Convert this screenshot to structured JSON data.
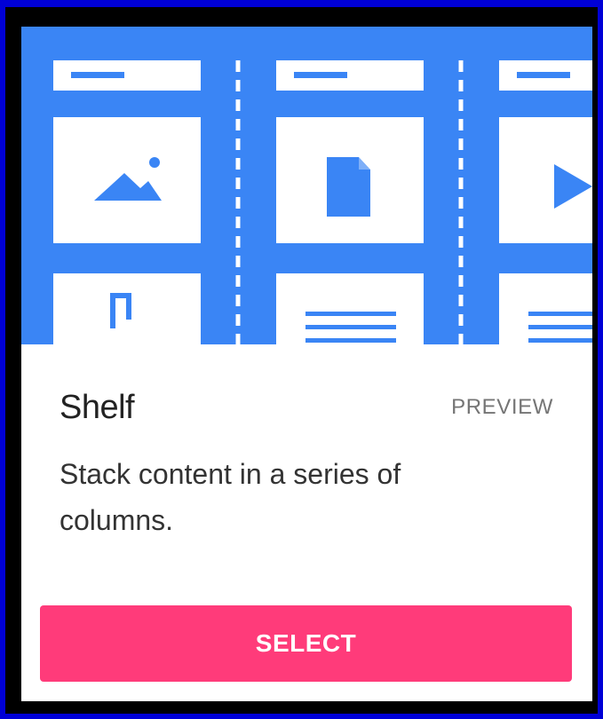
{
  "card": {
    "illustration": {
      "name": "shelf-layout-illustration",
      "background": "#3a85f5",
      "icons": [
        "image-icon",
        "document-icon",
        "play-icon",
        "music-icon"
      ]
    },
    "title": "Shelf",
    "preview_label": "PREVIEW",
    "description": "Stack content in a series of columns.",
    "select_label": "SELECT"
  },
  "colors": {
    "outer_border": "#0000d6",
    "accent": "#3a85f5",
    "button": "#ff3b7a",
    "card_background": "#ffffff"
  }
}
